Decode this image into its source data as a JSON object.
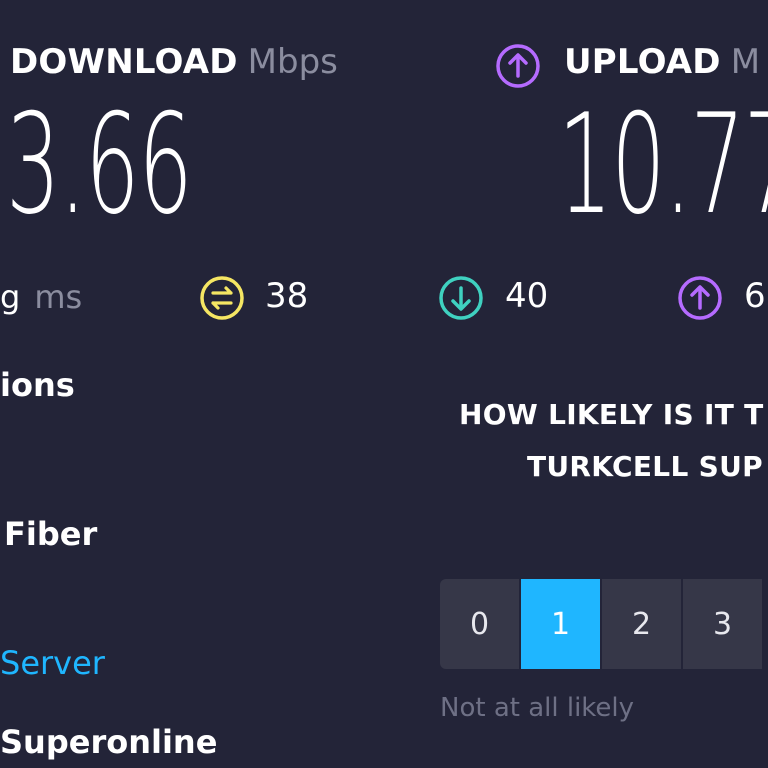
{
  "download": {
    "label": "DOWNLOAD",
    "unit": "Mbps",
    "value": "3.66"
  },
  "upload": {
    "label": "UPLOAD",
    "unit_partial": "M",
    "value_partial": "10.77"
  },
  "ping": {
    "label_partial": "g",
    "unit": "ms",
    "idle": "38",
    "download": "40",
    "upload_partial": "6"
  },
  "left_panel": {
    "section_title_partial": "ions",
    "isp_partial": "Fiber",
    "server_link_partial": "Server",
    "provider_partial": "Superonline"
  },
  "survey": {
    "question_line1_partial": "HOW LIKELY IS IT T",
    "question_line2_partial": "TURKCELL SUP",
    "options": [
      "0",
      "1",
      "2",
      "3"
    ],
    "selected": "1",
    "hint_low": "Not at all likely"
  },
  "colors": {
    "background": "#232438",
    "accent_blue": "#1fb6ff",
    "upload_purple": "#b56bff",
    "idle_yellow": "#f5e663",
    "download_teal": "#3fd1c0",
    "muted_text": "#8b8d9f"
  },
  "icons": {
    "upload": "arrow-up-circle",
    "idle": "jitter-circle",
    "download": "arrow-down-circle",
    "upload_small": "arrow-up-circle"
  }
}
